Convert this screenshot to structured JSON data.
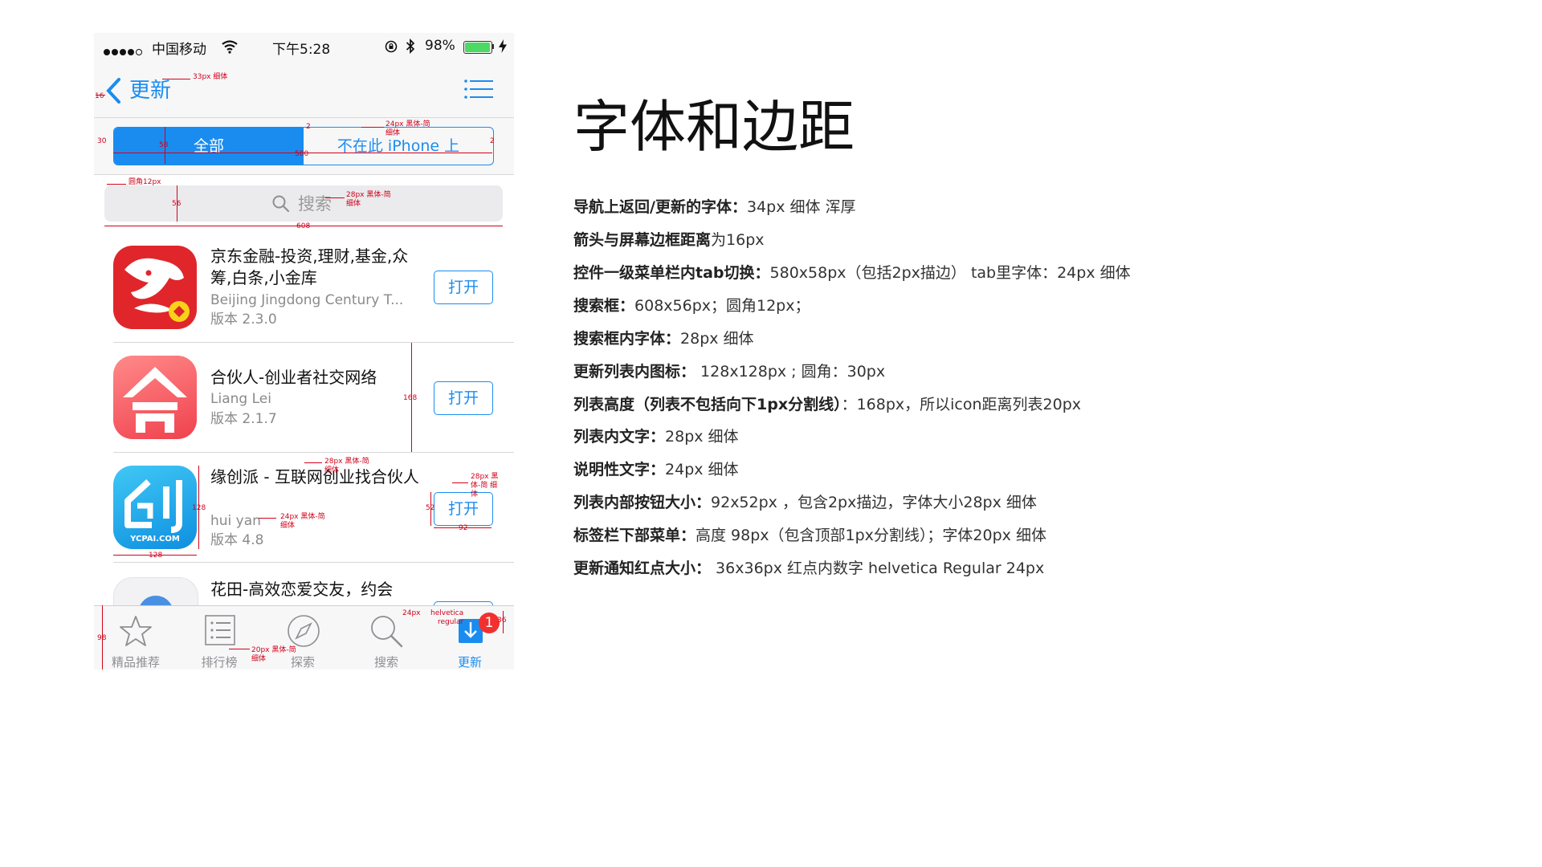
{
  "colors": {
    "accent": "#1a8cf0",
    "badge": "#f2312f",
    "annotation": "#d0021b",
    "battery": "#4cd964"
  },
  "status_bar": {
    "carrier": "中国移动",
    "time": "下午5:28",
    "battery": "98%"
  },
  "nav": {
    "back_label": "更新",
    "icon_back": "chevron-left-icon",
    "icon_menu": "list-icon"
  },
  "segment": {
    "tabs": [
      "全部",
      "不在此 iPhone 上"
    ]
  },
  "search": {
    "placeholder": "搜索"
  },
  "apps": [
    {
      "title": "京东金融-投资,理财,基金,众筹,白条,小金库",
      "developer": "Beijing Jingdong Century T...",
      "version": "版本 2.3.0",
      "button": "打开"
    },
    {
      "title": "合伙人-创业者社交网络",
      "developer": "Liang Lei",
      "version": "版本 2.1.7",
      "button": "打开"
    },
    {
      "title": "缘创派 - 互联网创业找合伙人",
      "developer": "hui yan",
      "version": "版本 4.8",
      "button": "打开",
      "icon_text": "YCPAI.COM"
    },
    {
      "title": "花田-高效恋爱交友，约会",
      "developer": "",
      "version": "",
      "button": ""
    }
  ],
  "tabbar": {
    "tabs": [
      {
        "label": "精品推荐",
        "icon": "star-icon"
      },
      {
        "label": "排行榜",
        "icon": "ranking-list-icon"
      },
      {
        "label": "探索",
        "icon": "compass-icon"
      },
      {
        "label": "搜索",
        "icon": "search-icon"
      },
      {
        "label": "更新",
        "icon": "download-icon"
      }
    ],
    "badge": "1"
  },
  "annotations": {
    "nav_font": "33px  细体",
    "arrow_margin": "16",
    "seg_height": "30",
    "seg_inner": "58",
    "seg_width": "580",
    "seg_border": "2",
    "seg_font_line1": "24px 黑体-简",
    "seg_font_line2": "细体",
    "search_radius": "圆角12px",
    "search_height": "56",
    "search_font_line1": "28px 黑体-简",
    "search_font_line2": "细体",
    "search_width": "608",
    "row_height": "168",
    "title_font_line1": "28px 黑体-简",
    "title_font_line2": "细体",
    "btn_font_line1": "28px 黑",
    "btn_font_line2": "体-简 细",
    "btn_font_line3": "体",
    "btn_height": "52",
    "btn_width": "92",
    "sub_font_line1": "24px 黑体-简",
    "sub_font_line2": "细体",
    "icon_size_v": "128",
    "icon_size_h": "128",
    "tab_font_line1": "20px 黑体-简",
    "tab_font_line2": "细体",
    "tab_height": "98",
    "badge_font_line1": "helvetica",
    "badge_font_line2": "regular",
    "badge_num_size": "24px",
    "badge_size": "36"
  },
  "right_panel": {
    "heading": "字体和边距",
    "specs": [
      {
        "label": "导航上返回/更新的字体：",
        "value": "34px 细体 浑厚"
      },
      {
        "label": "箭头与屏幕边框距离",
        "value": "为16px"
      },
      {
        "label": "控件一级菜单栏内tab切换：",
        "value": "580x58px（包括2px描边） tab里字体：24px 细体"
      },
      {
        "label": "搜索框：",
        "value": "608x56px；圆角12px；"
      },
      {
        "label": "搜索框内字体：",
        "value": "28px 细体"
      },
      {
        "label": "更新列表内图标：",
        "value": " 128x128px ; 圆角：30px"
      },
      {
        "label": "列表高度（列表不包括向下1px分割线）",
        "value": "：168px，所以icon距离列表20px"
      },
      {
        "label": "列表内文字：",
        "value": "28px 细体"
      },
      {
        "label": "说明性文字：",
        "value": "24px 细体"
      },
      {
        "label": "列表内部按钮大小：",
        "value": "92x52px ，包含2px描边，字体大小28px 细体"
      },
      {
        "label": "标签栏下部菜单：",
        "value": "高度 98px（包含顶部1px分割线）；字体20px 细体"
      },
      {
        "label": "更新通知红点大小：",
        "value": " 36x36px 红点内数字 helvetica Regular 24px"
      }
    ]
  }
}
